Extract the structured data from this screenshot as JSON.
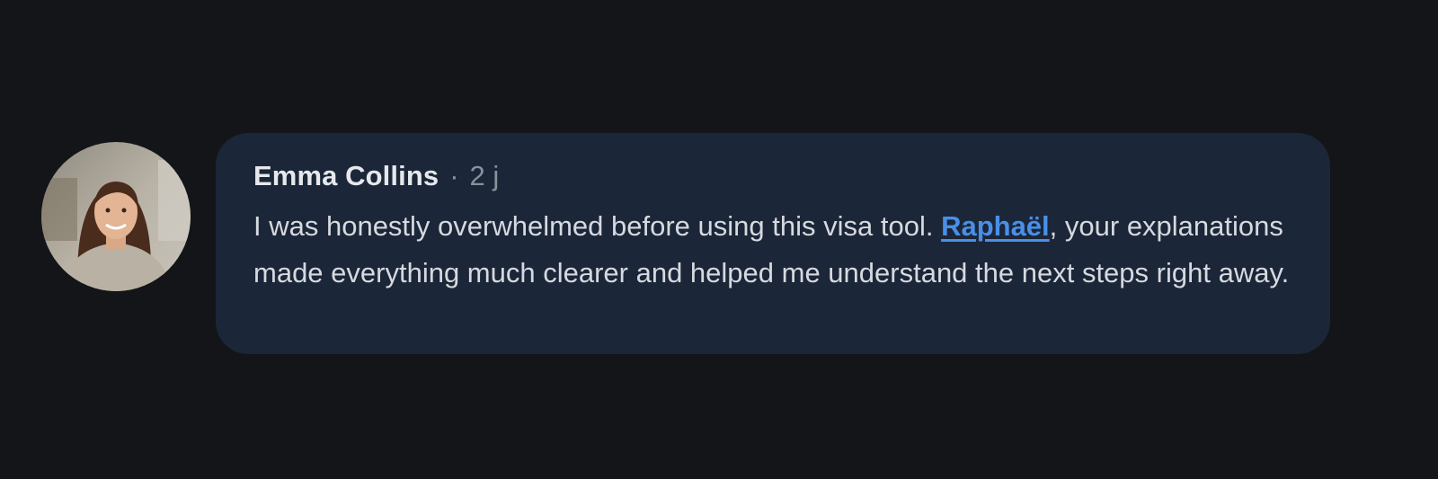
{
  "comment": {
    "author": "Emma Collins",
    "separator": "·",
    "timestamp": "2 j",
    "text_before": "I was honestly overwhelmed before using this visa tool. ",
    "mention": "Raphaël",
    "text_after": ", your explanations made everything much clearer and helped me understand the next steps right away."
  },
  "colors": {
    "background": "#141518",
    "bubble": "#1b2638",
    "author_text": "#e6e8ec",
    "meta_text": "#8b919c",
    "body_text": "#d6d9df",
    "mention": "#4a8fe7"
  }
}
